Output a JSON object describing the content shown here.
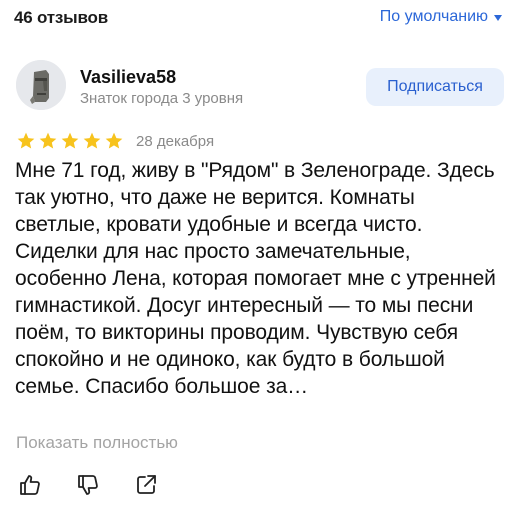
{
  "header": {
    "reviews_count": "46 отзывов",
    "sort_label": "По умолчанию"
  },
  "review": {
    "author": {
      "name": "Vasilieva58",
      "level": "Знаток города 3 уровня",
      "avatar_icon": "moai-statue-avatar"
    },
    "subscribe_label": "Подписаться",
    "rating": 5,
    "rating_max": 5,
    "date": "28 декабря",
    "text": "Мне 71 год, живу в \"Рядом\" в Зеленограде. Здесь так уютно, что даже не верится. Комнаты светлые, кровати удобные и всегда чисто. Сиделки для нас просто замечательные, особенно Лена, которая помогает мне с утренней гимнастикой. Досуг интересный — то мы песни поём, то викторины проводим. Чувствую себя спокойно и не одиноко, как будто в большой семье. Спасибо большое за…",
    "show_more_label": "Показать полностью",
    "actions": [
      "thumbs-up-icon",
      "thumbs-down-icon",
      "share-icon"
    ]
  },
  "colors": {
    "accent": "#2b67d8",
    "star": "#f7c31d",
    "muted": "#8a8a8a",
    "button_bg": "#e8f0fc"
  }
}
